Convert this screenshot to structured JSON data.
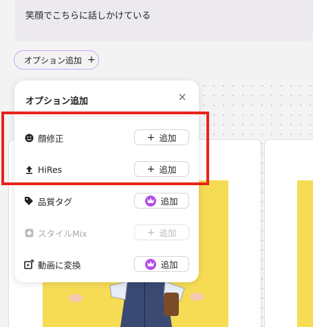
{
  "prompt": {
    "text": "笑顔でこちらに話しかけている"
  },
  "chip": {
    "label": "オプション追加",
    "plus": "+"
  },
  "popover": {
    "title": "オプション追加",
    "close": "×",
    "rows": [
      {
        "icon": "face-icon",
        "label": "顔修正",
        "button": "追加",
        "premium": false,
        "disabled": false
      },
      {
        "icon": "upload-icon",
        "label": "HiRes",
        "button": "追加",
        "premium": false,
        "disabled": false
      },
      {
        "icon": "tag-icon",
        "label": "品質タグ",
        "button": "追加",
        "premium": true,
        "disabled": false
      },
      {
        "icon": "style-mix-icon",
        "label": "スタイルMix",
        "button": "追加",
        "premium": false,
        "disabled": true
      },
      {
        "icon": "video-convert-icon",
        "label": "動画に変換",
        "button": "追加",
        "premium": true,
        "disabled": false
      }
    ]
  },
  "colors": {
    "highlight": "#e8231b",
    "premium": "#b24de8",
    "art_bg": "#f6dc55"
  }
}
